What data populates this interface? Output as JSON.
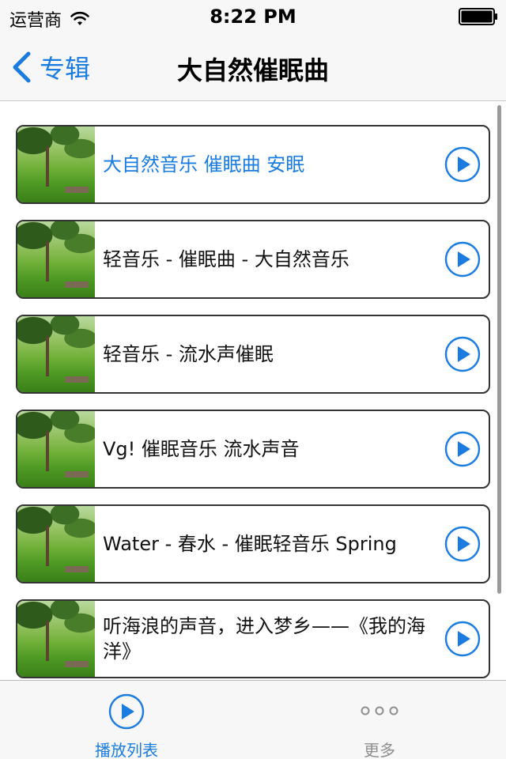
{
  "status_bar": {
    "carrier": "运营商",
    "time": "8:22 PM",
    "wifi_icon": "wifi-icon",
    "battery_icon": "battery-icon"
  },
  "nav": {
    "back_label": "专辑",
    "back_icon": "chevron-left-icon",
    "title": "大自然催眠曲"
  },
  "tracks": [
    {
      "title": "大自然音乐 催眠曲 安眠",
      "selected": true
    },
    {
      "title": "轻音乐 - 催眠曲 - 大自然音乐",
      "selected": false
    },
    {
      "title": "轻音乐 - 流水声催眠",
      "selected": false
    },
    {
      "title": "Vg! 催眠音乐 流水声音",
      "selected": false
    },
    {
      "title": "Water - 春水 - 催眠轻音乐 Spring",
      "selected": false
    },
    {
      "title": "听海浪的声音，进入梦乡——《我的海洋》",
      "selected": false
    }
  ],
  "tab_bar": {
    "tabs": [
      {
        "label": "播放列表",
        "icon": "play-circle-icon",
        "active": true
      },
      {
        "label": "更多",
        "icon": "more-dots-icon",
        "active": false
      }
    ]
  },
  "colors": {
    "accent": "#1a7ce0",
    "bar_background": "#f7f7f7",
    "card_border": "#333333",
    "inactive_tab": "#8e8e8e"
  }
}
